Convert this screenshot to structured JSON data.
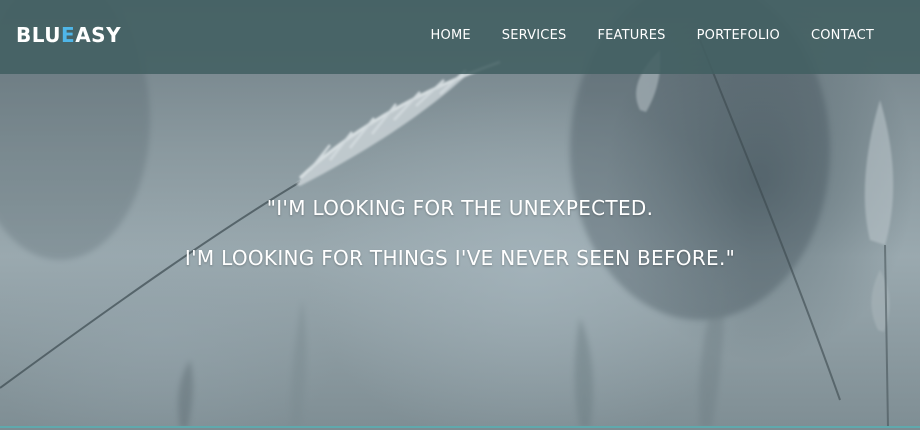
{
  "brand": {
    "part1": "BLU",
    "accent": "E",
    "part2": "ASY",
    "accent_color": "#4fb6e8"
  },
  "nav": {
    "items": [
      {
        "label": "HOME"
      },
      {
        "label": "SERVICES"
      },
      {
        "label": "FEATURES"
      },
      {
        "label": "PORTEFOLIO"
      },
      {
        "label": "CONTACT"
      }
    ]
  },
  "hero": {
    "quote_line1": "\"I'M LOOKING FOR THE UNEXPECTED.",
    "quote_line2": "I'M LOOKING FOR THINGS I'VE NEVER SEEN BEFORE.\"",
    "background": "wheat-grass-photo",
    "navbar_color": "#426062"
  }
}
